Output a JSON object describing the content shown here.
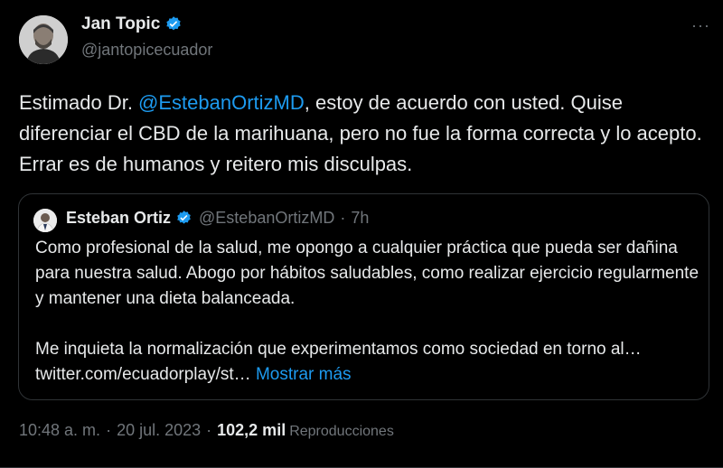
{
  "author": {
    "name": "Jan Topic",
    "handle": "@jantopicecuador"
  },
  "more_icon": "more-horizontal-icon",
  "tweet": {
    "text_before": "Estimado Dr. ",
    "mention": "@EstebanOrtizMD",
    "text_after": ", estoy de acuerdo con usted. Quise diferenciar el CBD de la marihuana, pero no fue la forma correcta y lo acepto. Errar es de humanos y reitero mis disculpas."
  },
  "quote": {
    "name": "Esteban Ortiz",
    "handle": "@EstebanOrtizMD",
    "separator": "·",
    "time": "7h",
    "paragraph1": "Como profesional de la salud, me opongo a cualquier práctica que pueda ser dañina para nuestra salud. Abogo por hábitos saludables, como realizar ejercicio regularmente y mantener una dieta balanceada.",
    "paragraph2_text": "Me inquieta la normalización que experimentamos como sociedad en torno al… ",
    "link": "twitter.com/ecuadorplay/st…",
    "show_more": "Mostrar más"
  },
  "meta": {
    "time": "10:48 a. m.",
    "date": "20 jul. 2023",
    "separator": "·",
    "views_count": "102,2 mil",
    "views_label": "Reproducciones"
  },
  "colors": {
    "background": "#000000",
    "text": "#e7e9ea",
    "secondary": "#71767b",
    "accent": "#1d9bf0",
    "border": "#2f3336"
  }
}
